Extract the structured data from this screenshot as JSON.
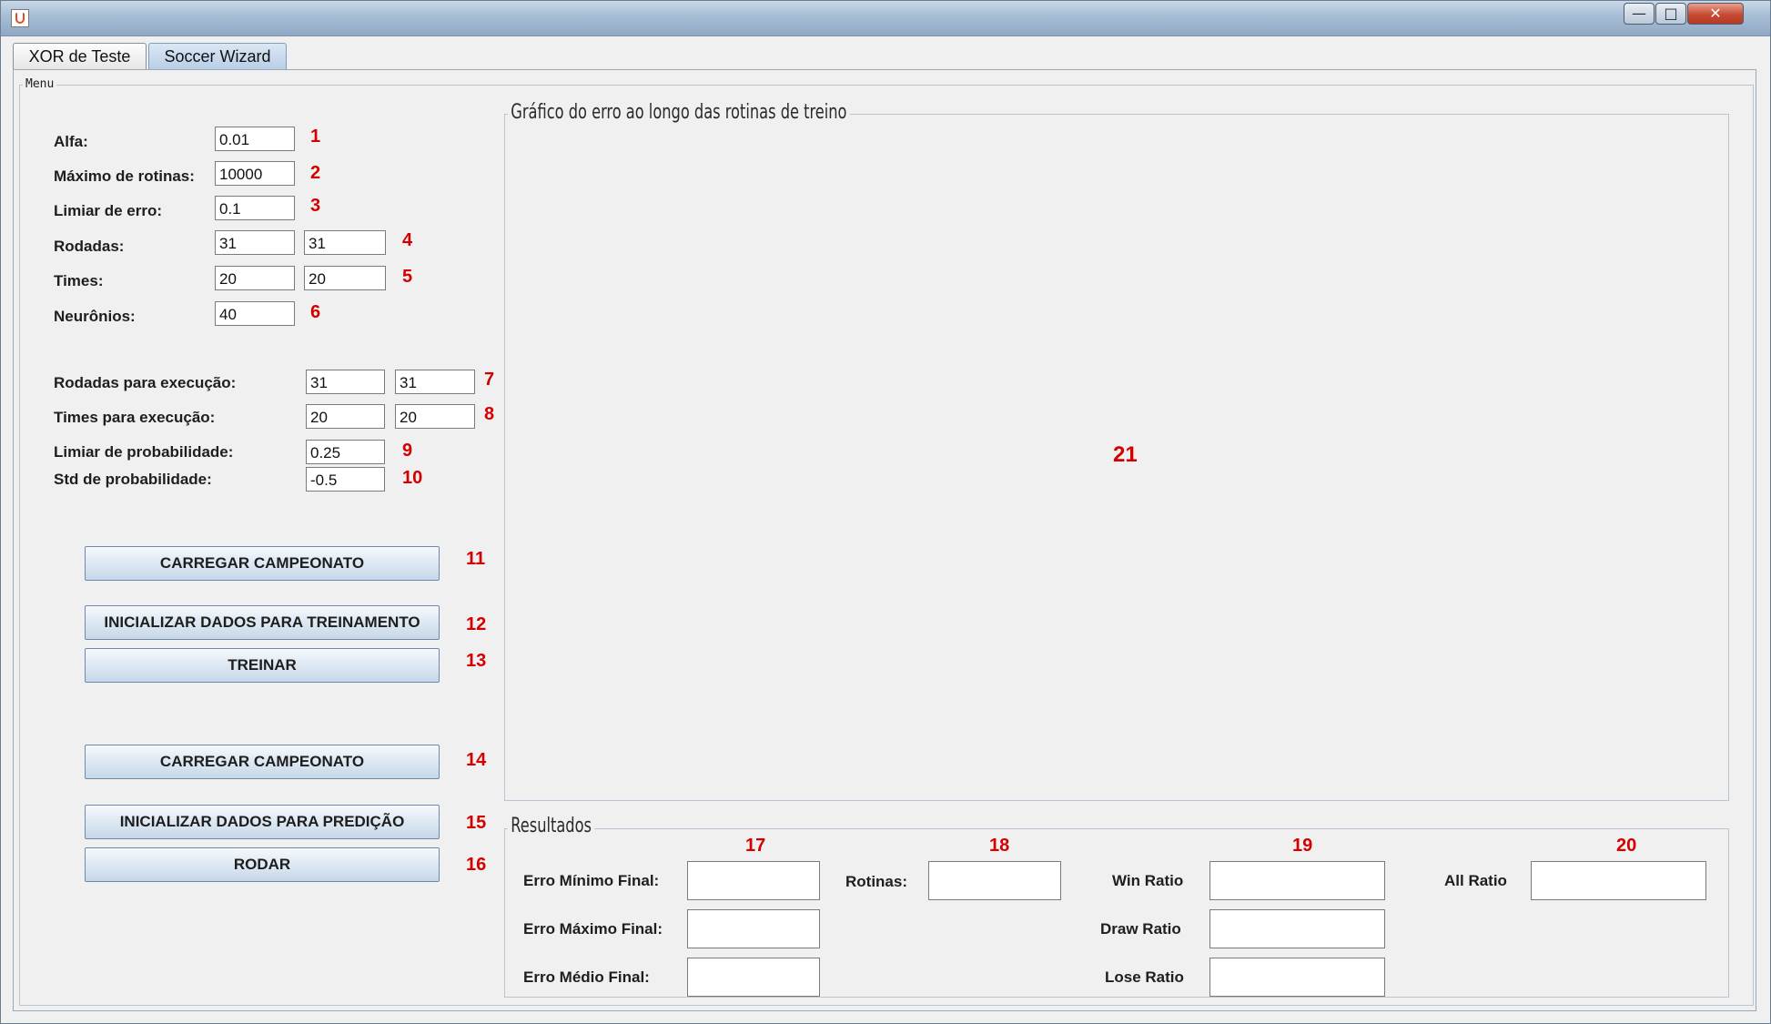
{
  "window": {
    "title": "",
    "controls": {
      "minimize": "—",
      "maximize": "□",
      "close": "✕"
    }
  },
  "tabs": [
    {
      "label": "XOR de Teste",
      "active": false
    },
    {
      "label": "Soccer Wizard",
      "active": true
    }
  ],
  "menu": {
    "title": "Menu",
    "params": {
      "alfa": {
        "label": "Alfa:",
        "value": "0.01",
        "marker": "1"
      },
      "max_rotinas": {
        "label": "Máximo de rotinas:",
        "value": "10000",
        "marker": "2"
      },
      "limiar_erro": {
        "label": "Limiar de erro:",
        "value": "0.1",
        "marker": "3"
      },
      "rodadas": {
        "label": "Rodadas:",
        "value1": "31",
        "value2": "31",
        "marker": "4"
      },
      "times": {
        "label": "Times:",
        "value1": "20",
        "value2": "20",
        "marker": "5"
      },
      "neuronios": {
        "label": "Neurônios:",
        "value": "40",
        "marker": "6"
      }
    },
    "exec": {
      "rodadas_exec": {
        "label": "Rodadas para execução:",
        "value1": "31",
        "value2": "31",
        "marker": "7"
      },
      "times_exec": {
        "label": "Times para execução:",
        "value1": "20",
        "value2": "20",
        "marker": "8"
      },
      "limiar_prob": {
        "label": "Limiar de probabilidade:",
        "value": "0.25",
        "marker": "9"
      },
      "std_prob": {
        "label": "Std de probabilidade:",
        "value": "-0.5",
        "marker": "10"
      }
    },
    "buttons": {
      "carregar_1": {
        "label": "CARREGAR CAMPEONATO",
        "marker": "11"
      },
      "inicializar_treino": {
        "label": "INICIALIZAR DADOS PARA TREINAMENTO",
        "marker": "12"
      },
      "treinar": {
        "label": "TREINAR",
        "marker": "13"
      },
      "carregar_2": {
        "label": "CARREGAR CAMPEONATO",
        "marker": "14"
      },
      "inicializar_predicao": {
        "label": "INICIALIZAR DADOS PARA PREDIÇÃO",
        "marker": "15"
      },
      "rodar": {
        "label": "RODAR",
        "marker": "16"
      }
    }
  },
  "chart_panel": {
    "title": "Gráfico do erro ao longo das rotinas de treino",
    "marker": "21"
  },
  "results": {
    "title": "Resultados",
    "markers": {
      "col1": "17",
      "col2": "18",
      "col3": "19",
      "col4": "20"
    },
    "erro_minimo": {
      "label": "Erro Mínimo Final:",
      "value": ""
    },
    "erro_maximo": {
      "label": "Erro Máximo Final:",
      "value": ""
    },
    "erro_medio": {
      "label": "Erro Médio Final:",
      "value": ""
    },
    "rotinas": {
      "label": "Rotinas:",
      "value": ""
    },
    "win_ratio": {
      "label": "Win Ratio",
      "value": ""
    },
    "draw_ratio": {
      "label": "Draw Ratio",
      "value": ""
    },
    "lose_ratio": {
      "label": "Lose Ratio",
      "value": ""
    },
    "all_ratio": {
      "label": "All Ratio",
      "value": ""
    }
  },
  "colors": {
    "marker": "#d40000",
    "panel_bg": "#f0f0f0",
    "active_tab": "#b8cfe7"
  }
}
